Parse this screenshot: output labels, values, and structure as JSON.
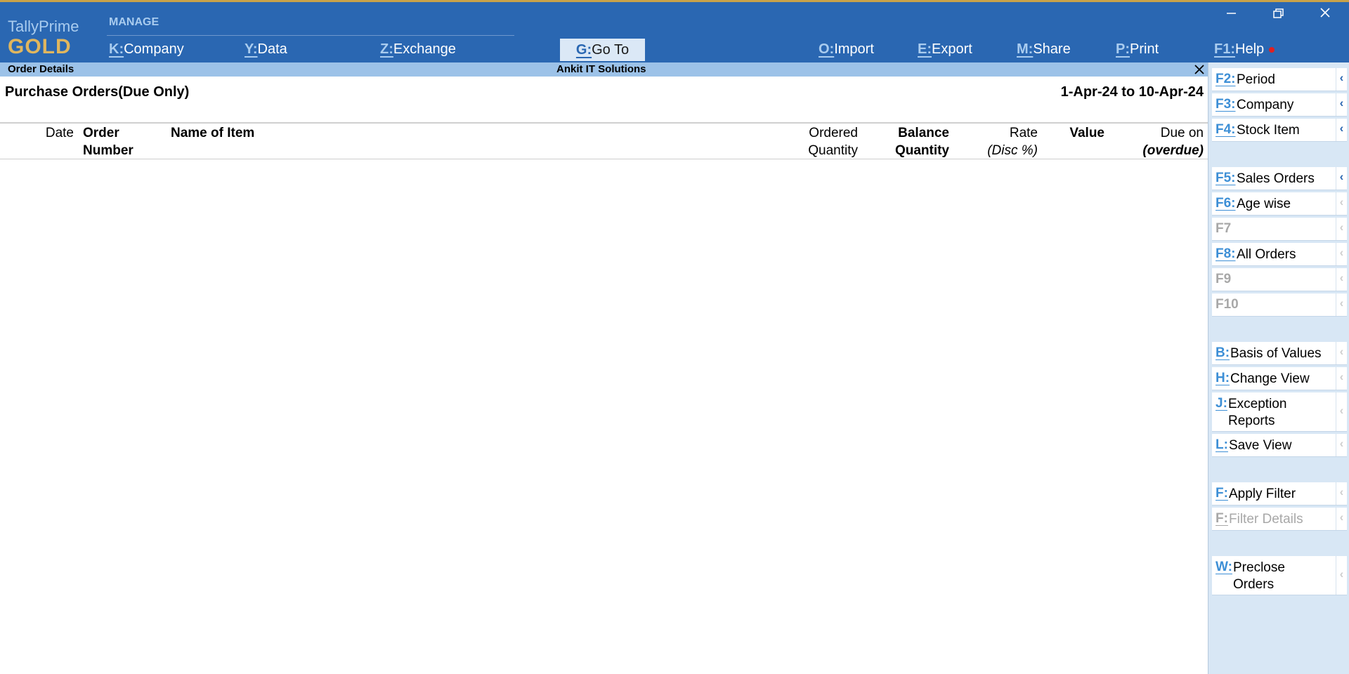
{
  "brand": {
    "name": "TallyPrime",
    "edition": "GOLD"
  },
  "topbar": {
    "group_label": "MANAGE",
    "menu": [
      {
        "key": "K:",
        "label": "Company"
      },
      {
        "key": "Y:",
        "label": "Data"
      },
      {
        "key": "Z:",
        "label": "Exchange"
      },
      {
        "key": "G:",
        "label": "Go To"
      },
      {
        "key": "O:",
        "label": "Import"
      },
      {
        "key": "E:",
        "label": "Export"
      },
      {
        "key": "M:",
        "label": "Share"
      },
      {
        "key": "P:",
        "label": "Print"
      },
      {
        "key": "F1:",
        "label": "Help"
      }
    ]
  },
  "title_strip": {
    "report": "Order Details",
    "company": "Ankit IT Solutions"
  },
  "report": {
    "title": "Purchase Orders(Due Only)",
    "period": "1-Apr-24 to 10-Apr-24",
    "columns": {
      "date": "Date",
      "order_number_1": "Order",
      "order_number_2": "Number",
      "item": "Name of Item",
      "ordered_1": "Ordered",
      "ordered_2": "Quantity",
      "balance_1": "Balance",
      "balance_2": "Quantity",
      "rate_1": "Rate",
      "rate_2": "(Disc %)",
      "value": "Value",
      "due_1": "Due on",
      "due_2": "(overdue)"
    }
  },
  "side_panel": [
    {
      "key": "F2:",
      "label": "Period",
      "state": "active"
    },
    {
      "key": "F3:",
      "label": "Company",
      "state": "active"
    },
    {
      "key": "F4:",
      "label": "Stock Item",
      "state": "active"
    },
    {
      "key": "F5:",
      "label": "Sales Orders",
      "state": "active"
    },
    {
      "key": "F6:",
      "label": "Age wise",
      "state": "dim"
    },
    {
      "key": "F7",
      "label": "",
      "state": "disabled"
    },
    {
      "key": "F8:",
      "label": "All Orders",
      "state": "dim"
    },
    {
      "key": "F9",
      "label": "",
      "state": "disabled"
    },
    {
      "key": "F10",
      "label": "",
      "state": "disabled"
    },
    {
      "key": "B:",
      "label": "Basis of Values",
      "state": "dim"
    },
    {
      "key": "H:",
      "label": "Change View",
      "state": "dim"
    },
    {
      "key": "J:",
      "label": "Exception",
      "label2": "Reports",
      "state": "dim"
    },
    {
      "key": "L:",
      "label": "Save View",
      "state": "dim"
    },
    {
      "key": "F:",
      "label": "Apply Filter",
      "state": "dim"
    },
    {
      "key": "F:",
      "label": "Filter Details",
      "state": "disabled"
    },
    {
      "key": "W:",
      "label": "Preclose",
      "label2": "Orders",
      "state": "dim"
    }
  ],
  "icons": {
    "arrow": "chevron-left-icon"
  }
}
